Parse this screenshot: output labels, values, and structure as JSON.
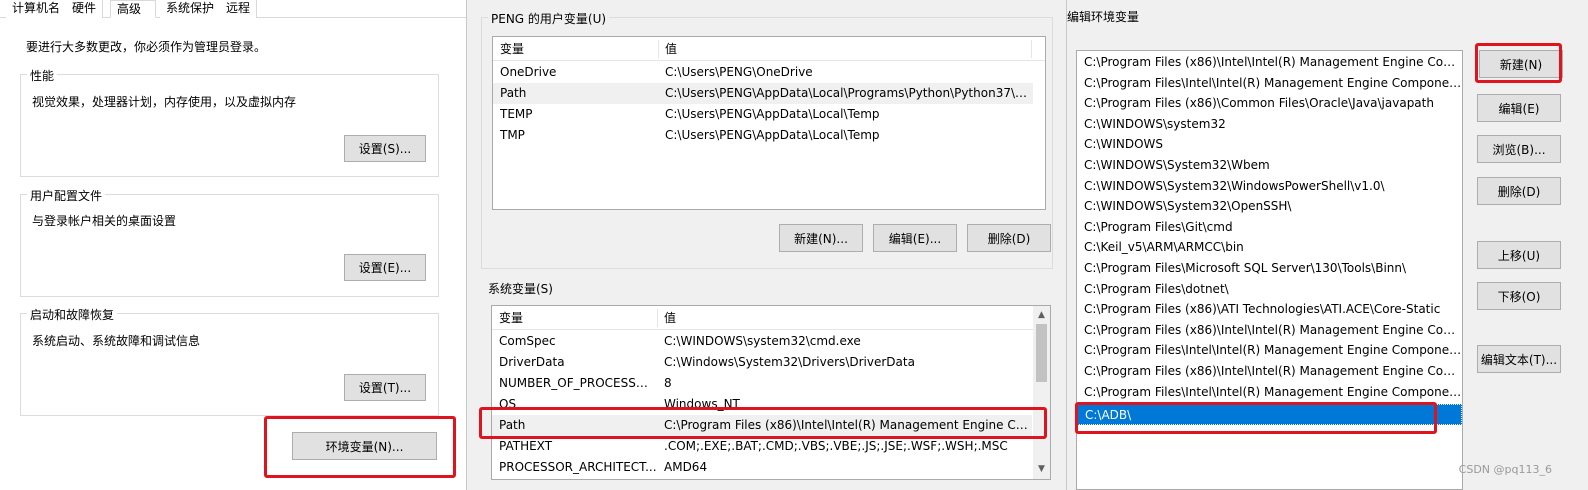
{
  "system_properties": {
    "tabs": [
      "计算机名",
      "硬件",
      "高级",
      "系统保护",
      "远程"
    ],
    "admin_note": "要进行大多数更改，你必须作为管理员登录。",
    "performance": {
      "title": "性能",
      "description": "视觉效果，处理器计划，内存使用，以及虚拟内存",
      "button": "设置(S)..."
    },
    "user_profiles": {
      "title": "用户配置文件",
      "description": "与登录帐户相关的桌面设置",
      "button": "设置(E)..."
    },
    "startup_recovery": {
      "title": "启动和故障恢复",
      "description": "系统启动、系统故障和调试信息",
      "button": "设置(T)..."
    },
    "env_button": "环境变量(N)..."
  },
  "environment_variables": {
    "user_group_title": "PENG 的用户变量(U)",
    "columns": {
      "variable": "变量",
      "value": "值"
    },
    "user_vars": [
      {
        "name": "OneDrive",
        "value": "C:\\Users\\PENG\\OneDrive"
      },
      {
        "name": "Path",
        "value": "C:\\Users\\PENG\\AppData\\Local\\Programs\\Python\\Python37\\S..."
      },
      {
        "name": "TEMP",
        "value": "C:\\Users\\PENG\\AppData\\Local\\Temp"
      },
      {
        "name": "TMP",
        "value": "C:\\Users\\PENG\\AppData\\Local\\Temp"
      }
    ],
    "user_buttons": {
      "new": "新建(N)...",
      "edit": "编辑(E)...",
      "delete": "删除(D)"
    },
    "system_group_title": "系统变量(S)",
    "system_vars": [
      {
        "name": "ComSpec",
        "value": "C:\\WINDOWS\\system32\\cmd.exe"
      },
      {
        "name": "DriverData",
        "value": "C:\\Windows\\System32\\Drivers\\DriverData"
      },
      {
        "name": "NUMBER_OF_PROCESSORS",
        "value": "8"
      },
      {
        "name": "OS",
        "value": "Windows_NT"
      },
      {
        "name": "Path",
        "value": "C:\\Program Files (x86)\\Intel\\Intel(R) Management Engine Co..."
      },
      {
        "name": "PATHEXT",
        "value": ".COM;.EXE;.BAT;.CMD;.VBS;.VBE;.JS;.JSE;.WSF;.WSH;.MSC"
      },
      {
        "name": "PROCESSOR_ARCHITECT...",
        "value": "AMD64"
      }
    ]
  },
  "edit_env_var": {
    "title": "编辑环境变量",
    "paths": [
      "C:\\Program Files (x86)\\Intel\\Intel(R) Management Engine Comp...",
      "C:\\Program Files\\Intel\\Intel(R) Management Engine Component...",
      "C:\\Program Files (x86)\\Common Files\\Oracle\\Java\\javapath",
      "C:\\WINDOWS\\system32",
      "C:\\WINDOWS",
      "C:\\WINDOWS\\System32\\Wbem",
      "C:\\WINDOWS\\System32\\WindowsPowerShell\\v1.0\\",
      "C:\\WINDOWS\\System32\\OpenSSH\\",
      "C:\\Program Files\\Git\\cmd",
      "C:\\Keil_v5\\ARM\\ARMCC\\bin",
      "C:\\Program Files\\Microsoft SQL Server\\130\\Tools\\Binn\\",
      "C:\\Program Files\\dotnet\\",
      "C:\\Program Files (x86)\\ATI Technologies\\ATI.ACE\\Core-Static",
      "C:\\Program Files (x86)\\Intel\\Intel(R) Management Engine Comp...",
      "C:\\Program Files\\Intel\\Intel(R) Management Engine Component...",
      "C:\\Program Files (x86)\\Intel\\Intel(R) Management Engine Comp...",
      "C:\\Program Files\\Intel\\Intel(R) Management Engine Component...",
      "C:\\ADB\\"
    ],
    "buttons": {
      "new": "新建(N)",
      "edit": "编辑(E)",
      "browse": "浏览(B)...",
      "delete": "删除(D)",
      "move_up": "上移(U)",
      "move_down": "下移(O)",
      "edit_text": "编辑文本(T)..."
    }
  },
  "watermark": "CSDN @pq113_6"
}
